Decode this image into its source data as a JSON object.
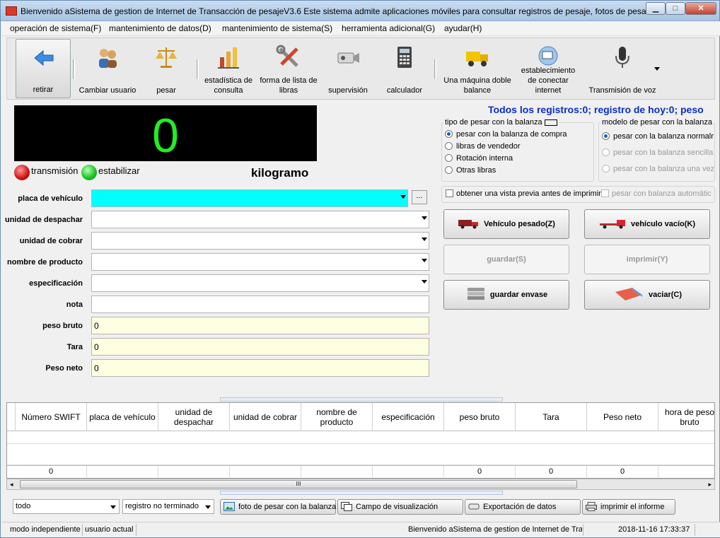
{
  "window": {
    "title": "Bienvenido aSistema de gestion de Internet de Transacción de pesajeV3.6 Este sistema admite aplicaciones móviles para consultar registros de pesaje, fotos de pesa...",
    "min_label": "▁",
    "max_label": "□",
    "close_label": "✕"
  },
  "menu": [
    {
      "label": "operación de sistema(F)"
    },
    {
      "label": "mantenimiento de datos(D)"
    },
    {
      "label": "mantenimiento de sistema(S)"
    },
    {
      "label": "herramienta adicional(G)"
    },
    {
      "label": "ayudar(H)"
    }
  ],
  "toolbar": {
    "items": [
      {
        "label": "retirar",
        "icon": "back-arrow-icon"
      },
      {
        "label": "Cambiar usuario",
        "icon": "users-icon"
      },
      {
        "label": "pesar",
        "icon": "scale-icon"
      },
      {
        "label": "estadística de consulta",
        "icon": "bar-chart-icon"
      },
      {
        "label": "forma de lista de libras",
        "icon": "tools-icon"
      },
      {
        "label": "supervisión",
        "icon": "camera-icon"
      },
      {
        "label": "calculador",
        "icon": "calculator-icon"
      },
      {
        "label": "Una máquina doble balance",
        "icon": "truck-icon"
      },
      {
        "label": "establecimiento de conectar internet",
        "icon": "network-icon"
      },
      {
        "label": "Transmisión de voz",
        "icon": "microphone-icon"
      }
    ]
  },
  "display": {
    "value": "0",
    "unit": "kilogramo",
    "transmission_label": "transmisión",
    "stabilize_label": "estabilizar"
  },
  "form": {
    "fields": [
      {
        "label": "placa de vehículo",
        "value": ""
      },
      {
        "label": "unidad de despachar",
        "value": ""
      },
      {
        "label": "unidad de cobrar",
        "value": ""
      },
      {
        "label": "nombre de producto",
        "value": ""
      },
      {
        "label": "especificación",
        "value": ""
      },
      {
        "label": "nota",
        "value": ""
      },
      {
        "label": "peso bruto",
        "value": "0"
      },
      {
        "label": "Tara",
        "value": "0"
      },
      {
        "label": "Peso neto",
        "value": "0"
      }
    ],
    "ellipsis_label": "..."
  },
  "records_total": "Todos los registros:0; registro de hoy:0; peso",
  "weigh_type": {
    "legend": "tipo de pesar con la balanza",
    "options": [
      {
        "label": "pesar con la balanza de compra",
        "selected": true
      },
      {
        "label": "libras de vendedor",
        "selected": false
      },
      {
        "label": "Rotación interna",
        "selected": false
      },
      {
        "label": "Otras libras",
        "selected": false
      }
    ]
  },
  "weigh_model": {
    "legend": "modelo de pesar con la balanza",
    "options": [
      {
        "label": "pesar con la balanza normalm",
        "selected": true,
        "enabled": true
      },
      {
        "label": "pesar con la balanza sencillan",
        "selected": false,
        "enabled": false
      },
      {
        "label": "pesar con la balanza una vez",
        "selected": false,
        "enabled": false
      }
    ]
  },
  "checks": {
    "preview": "obtener una vista previa antes de imprimir",
    "auto": "pesar con balanza automátic"
  },
  "actions": {
    "heavy": "Vehículo pesado(Z)",
    "empty": "vehículo vacío(K)",
    "save": "guardar(S)",
    "print": "imprimir(Y)",
    "save_tare": "guardar envase",
    "clear": "vaciar(C)"
  },
  "table": {
    "columns": [
      "Número SWIFT",
      "placa de vehículo",
      "unidad de despachar",
      "unidad de cobrar",
      "nombre de producto",
      "especificación",
      "peso bruto",
      "Tara",
      "Peso neto",
      "hora de peso bruto"
    ],
    "totals": [
      "0",
      "",
      "",
      "",
      "",
      "",
      "0",
      "0",
      "0",
      ""
    ],
    "scroll_grip": "III"
  },
  "bottom": {
    "filter1": "todo",
    "filter2": "registro no terminado",
    "photo_btn": "foto de pesar con la balanza",
    "field_btn": "Campo de visualización",
    "export_btn": "Exportación de datos",
    "print_btn": "imprimir el informe"
  },
  "status": {
    "mode": "modo independiente",
    "user": "usuario actual",
    "welcome": "Bienvenido aSistema de gestion de Internet de Trar",
    "datetime": "2018-11-16 17:33:37"
  }
}
